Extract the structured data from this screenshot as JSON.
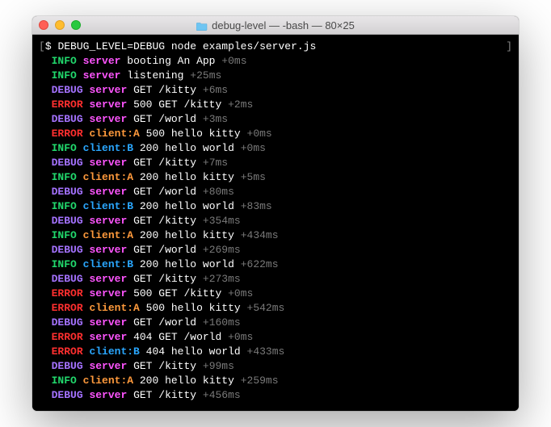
{
  "window": {
    "title": "debug-level — -bash — 80×25",
    "folder_icon": "folder"
  },
  "prompt": {
    "open": "[",
    "symbol": "$",
    "command": "DEBUG_LEVEL=DEBUG node examples/server.js",
    "close": "]"
  },
  "lines": [
    {
      "level": "INFO",
      "ns": "server",
      "nsClass": "ns-server",
      "msg": "booting An App",
      "time": "+0ms"
    },
    {
      "level": "INFO",
      "ns": "server",
      "nsClass": "ns-server",
      "msg": "listening",
      "time": "+25ms"
    },
    {
      "level": "DEBUG",
      "ns": "server",
      "nsClass": "ns-server",
      "msg": "GET /kitty",
      "time": "+6ms"
    },
    {
      "level": "ERROR",
      "ns": "server",
      "nsClass": "ns-server",
      "msg": "500 GET /kitty",
      "time": "+2ms"
    },
    {
      "level": "DEBUG",
      "ns": "server",
      "nsClass": "ns-server",
      "msg": "GET /world",
      "time": "+3ms"
    },
    {
      "level": "ERROR",
      "ns": "client:A",
      "nsClass": "ns-clientA",
      "msg": "500 hello kitty",
      "time": "+0ms"
    },
    {
      "level": "INFO",
      "ns": "client:B",
      "nsClass": "ns-clientB",
      "msg": "200 hello world",
      "time": "+0ms"
    },
    {
      "level": "DEBUG",
      "ns": "server",
      "nsClass": "ns-server",
      "msg": "GET /kitty",
      "time": "+7ms"
    },
    {
      "level": "INFO",
      "ns": "client:A",
      "nsClass": "ns-clientA",
      "msg": "200 hello kitty",
      "time": "+5ms"
    },
    {
      "level": "DEBUG",
      "ns": "server",
      "nsClass": "ns-server",
      "msg": "GET /world",
      "time": "+80ms"
    },
    {
      "level": "INFO",
      "ns": "client:B",
      "nsClass": "ns-clientB",
      "msg": "200 hello world",
      "time": "+83ms"
    },
    {
      "level": "DEBUG",
      "ns": "server",
      "nsClass": "ns-server",
      "msg": "GET /kitty",
      "time": "+354ms"
    },
    {
      "level": "INFO",
      "ns": "client:A",
      "nsClass": "ns-clientA",
      "msg": "200 hello kitty",
      "time": "+434ms"
    },
    {
      "level": "DEBUG",
      "ns": "server",
      "nsClass": "ns-server",
      "msg": "GET /world",
      "time": "+269ms"
    },
    {
      "level": "INFO",
      "ns": "client:B",
      "nsClass": "ns-clientB",
      "msg": "200 hello world",
      "time": "+622ms"
    },
    {
      "level": "DEBUG",
      "ns": "server",
      "nsClass": "ns-server",
      "msg": "GET /kitty",
      "time": "+273ms"
    },
    {
      "level": "ERROR",
      "ns": "server",
      "nsClass": "ns-server",
      "msg": "500 GET /kitty",
      "time": "+0ms"
    },
    {
      "level": "ERROR",
      "ns": "client:A",
      "nsClass": "ns-clientA",
      "msg": "500 hello kitty",
      "time": "+542ms"
    },
    {
      "level": "DEBUG",
      "ns": "server",
      "nsClass": "ns-server",
      "msg": "GET /world",
      "time": "+160ms"
    },
    {
      "level": "ERROR",
      "ns": "server",
      "nsClass": "ns-server",
      "msg": "404 GET /world",
      "time": "+0ms"
    },
    {
      "level": "ERROR",
      "ns": "client:B",
      "nsClass": "ns-clientB",
      "msg": "404 hello world",
      "time": "+433ms"
    },
    {
      "level": "DEBUG",
      "ns": "server",
      "nsClass": "ns-server",
      "msg": "GET /kitty",
      "time": "+99ms"
    },
    {
      "level": "INFO",
      "ns": "client:A",
      "nsClass": "ns-clientA",
      "msg": "200 hello kitty",
      "time": "+259ms"
    },
    {
      "level": "DEBUG",
      "ns": "server",
      "nsClass": "ns-server",
      "msg": "GET /kitty",
      "time": "+456ms"
    }
  ]
}
